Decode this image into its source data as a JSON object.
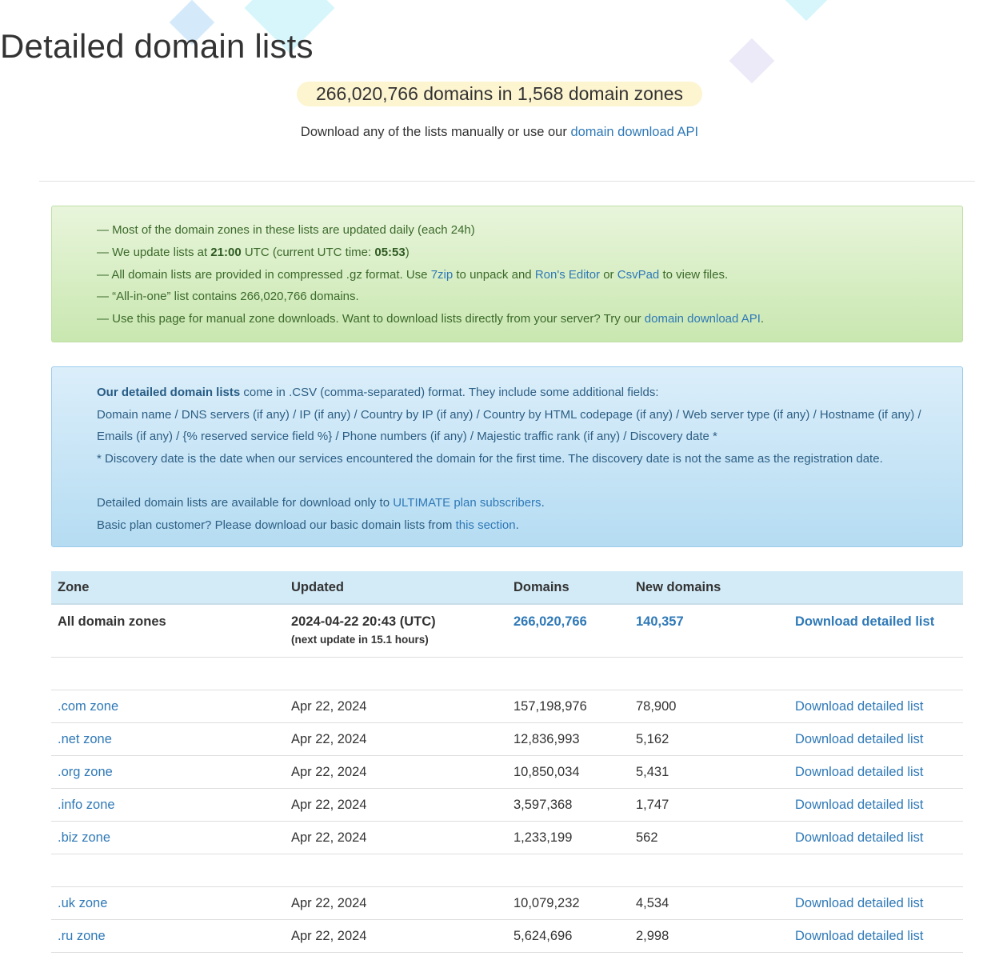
{
  "header": {
    "title": "Detailed domain lists",
    "summary": "266,020,766 domains in 1,568 domain zones",
    "subline_prefix": "Download any of the lists manually or use our",
    "subline_link": "domain download API"
  },
  "notice": {
    "l1": "— Most of the domain zones in these lists are updated daily (each 24h)",
    "l2_a": "— We update lists at",
    "l2_time": "21:00",
    "l2_b": "UTC (current UTC time:",
    "l2_now": "05:53",
    "l2_c": ")",
    "l3_a": "— All domain lists are provided in compressed .gz format. Use",
    "l3_link1": "7zip",
    "l3_b": "to unpack and",
    "l3_link2": "Ron's Editor",
    "l3_c": "or",
    "l3_link3": "CsvPad",
    "l3_d": "to view files.",
    "l4": "— “All-in-one” list contains 266,020,766 domains.",
    "l5_a": "— Use this page for manual zone downloads. Want to download lists directly from your server? Try our",
    "l5_link": "domain download API",
    "l5_b": "."
  },
  "info": {
    "l1_bold": "Our detailed domain lists",
    "l1_rest": "come in .CSV (comma-separated) format. They include some additional fields:",
    "l2": "Domain name / DNS servers (if any) / IP (if any) / Country by IP (if any) / Country by HTML codepage (if any) / Web server type (if any) / Hostname (if any) /",
    "l3": "Emails (if any) / {% reserved service field %} / Phone numbers (if any) / Majestic traffic rank (if any) / Discovery date *",
    "l4": "* Discovery date is the date when our services encountered the domain for the first time. The discovery date is not the same as the registration date.",
    "l5_a": "Detailed domain lists are available for download only to",
    "l5_link": "ULTIMATE plan subscribers",
    "l5_b": ".",
    "l6_a": "Basic plan customer? Please download our basic domain lists from",
    "l6_link": "this section",
    "l6_b": "."
  },
  "table": {
    "headers": {
      "zone": "Zone",
      "updated": "Updated",
      "domains": "Domains",
      "new": "New domains"
    },
    "all": {
      "zone": "All domain zones",
      "updated": "2024-04-22 20:43 (UTC)",
      "next": "(next update in 15.1 hours)",
      "domains": "266,020,766",
      "new": "140,357",
      "action": "Download detailed list"
    },
    "rows": [
      {
        "zone": ".com zone",
        "updated": "Apr 22, 2024",
        "domains": "157,198,976",
        "new": "78,900",
        "action": "Download detailed list"
      },
      {
        "zone": ".net zone",
        "updated": "Apr 22, 2024",
        "domains": "12,836,993",
        "new": "5,162",
        "action": "Download detailed list"
      },
      {
        "zone": ".org zone",
        "updated": "Apr 22, 2024",
        "domains": "10,850,034",
        "new": "5,431",
        "action": "Download detailed list"
      },
      {
        "zone": ".info zone",
        "updated": "Apr 22, 2024",
        "domains": "3,597,368",
        "new": "1,747",
        "action": "Download detailed list"
      },
      {
        "zone": ".biz zone",
        "updated": "Apr 22, 2024",
        "domains": "1,233,199",
        "new": "562",
        "action": "Download detailed list"
      },
      {
        "zone": ".uk zone",
        "updated": "Apr 22, 2024",
        "domains": "10,079,232",
        "new": "4,534",
        "action": "Download detailed list"
      },
      {
        "zone": ".ru zone",
        "updated": "Apr 22, 2024",
        "domains": "5,624,696",
        "new": "2,998",
        "action": "Download detailed list"
      }
    ]
  }
}
